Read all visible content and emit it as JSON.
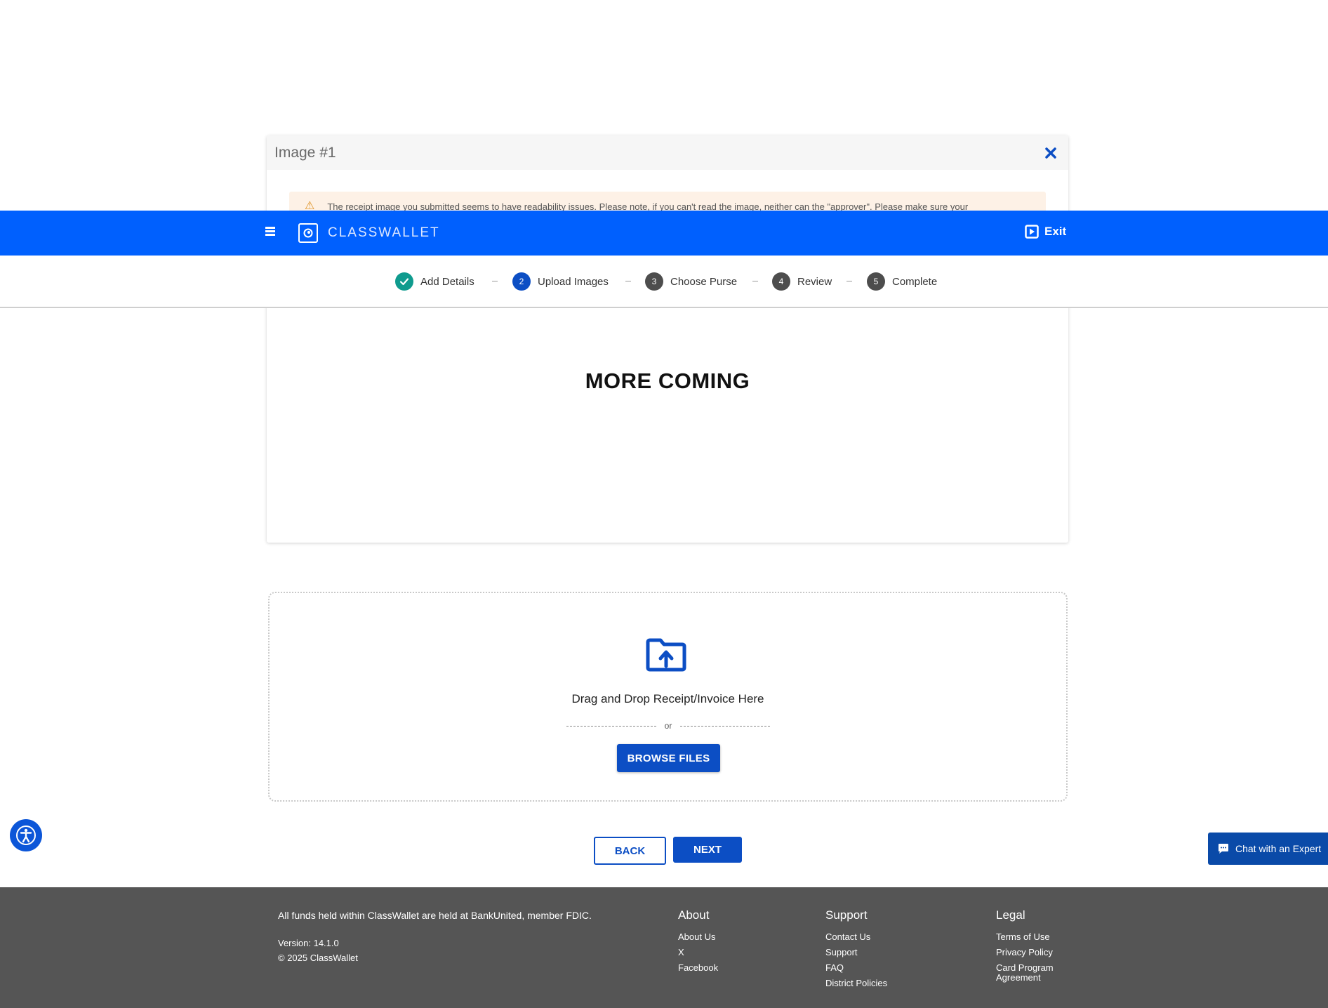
{
  "image_card": {
    "title": "Image #1",
    "warning": "The receipt image you submitted seems to have readability issues. Please note, if you can't read the image, neither can the \"approver\". Please make sure your",
    "content": "MORE COMING"
  },
  "header": {
    "logo_text": "CLASSWALLET",
    "exit_label": "Exit"
  },
  "stepper": {
    "steps": [
      {
        "num": "1",
        "label": "Add Details",
        "state": "done"
      },
      {
        "num": "2",
        "label": "Upload Images",
        "state": "active"
      },
      {
        "num": "3",
        "label": "Choose Purse",
        "state": "pending"
      },
      {
        "num": "4",
        "label": "Review",
        "state": "pending"
      },
      {
        "num": "5",
        "label": "Complete",
        "state": "pending"
      }
    ],
    "separator": "–"
  },
  "dropzone": {
    "text": "Drag and Drop Receipt/Invoice Here",
    "or": "or",
    "browse_label": "BROWSE FILES"
  },
  "nav": {
    "back_label": "BACK",
    "next_label": "NEXT"
  },
  "chat": {
    "label": "Chat with an Expert"
  },
  "footer": {
    "fdic": "All funds held within ClassWallet are held at BankUnited, member FDIC.",
    "version": "Version: 14.1.0",
    "copyright": "© 2025 ClassWallet",
    "about": {
      "title": "About",
      "links": [
        "About Us",
        "X",
        "Facebook"
      ]
    },
    "support": {
      "title": "Support",
      "links": [
        "Contact Us",
        "Support",
        "FAQ",
        "District Policies"
      ]
    },
    "legal": {
      "title": "Legal",
      "links": [
        "Terms of Use",
        "Privacy Policy",
        "Card Program Agreement"
      ]
    }
  },
  "colors": {
    "brand_blue": "#0060fe",
    "button_blue": "#0c4ec4",
    "step_done": "#0f9b8e",
    "footer_bg": "#555555"
  },
  "icons": [
    "close-icon",
    "warning-icon",
    "hamburger-icon",
    "classwallet-logo-icon",
    "exit-icon",
    "check-icon",
    "folder-upload-icon",
    "accessibility-icon",
    "chat-icon"
  ]
}
